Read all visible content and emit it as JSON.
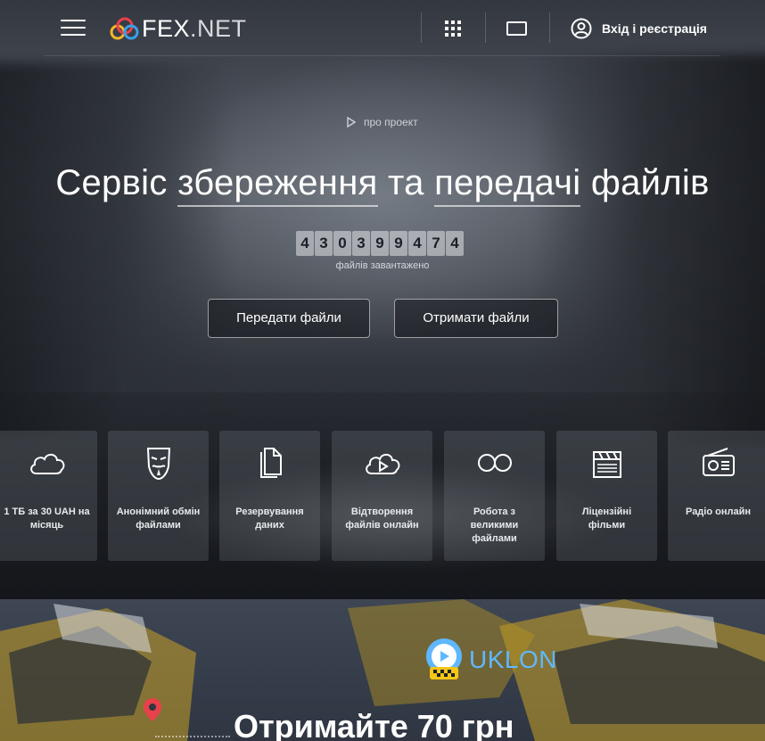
{
  "header": {
    "logo_fex": "FEX",
    "logo_net": ".NET",
    "login_label": "Вхід і реєстрація"
  },
  "hero": {
    "about_label": "про проект",
    "title_parts": [
      "Сервіс ",
      "збереження",
      " та ",
      "передачі",
      " файлів"
    ],
    "counter_digits": [
      "4",
      "3",
      "0",
      "3",
      "9",
      "9",
      "4",
      "7",
      "4"
    ],
    "counter_label": "файлів завантажено",
    "send_button": "Передати файли",
    "get_button": "Отримати файли"
  },
  "features": [
    {
      "label": "1 ТБ за 30 UAH на місяць",
      "icon": "cloud-icon"
    },
    {
      "label": "Анонімний обмін файлами",
      "icon": "anonymous-mask-icon"
    },
    {
      "label": "Резервування даних",
      "icon": "copy-files-icon"
    },
    {
      "label": "Відтворення файлів онлайн",
      "icon": "cloud-play-icon"
    },
    {
      "label": "Робота з великими файлами",
      "icon": "infinity-icon"
    },
    {
      "label": "Ліцензійні фільми",
      "icon": "clapperboard-icon"
    },
    {
      "label": "Радіо онлайн",
      "icon": "radio-icon"
    }
  ],
  "promo": {
    "brand": "UKLON",
    "title": "Отримайте 70 грн"
  },
  "colors": {
    "uklon_blue": "#5fb8ff",
    "uklon_yellow": "#f5c518",
    "pin_red": "#e8414b"
  }
}
